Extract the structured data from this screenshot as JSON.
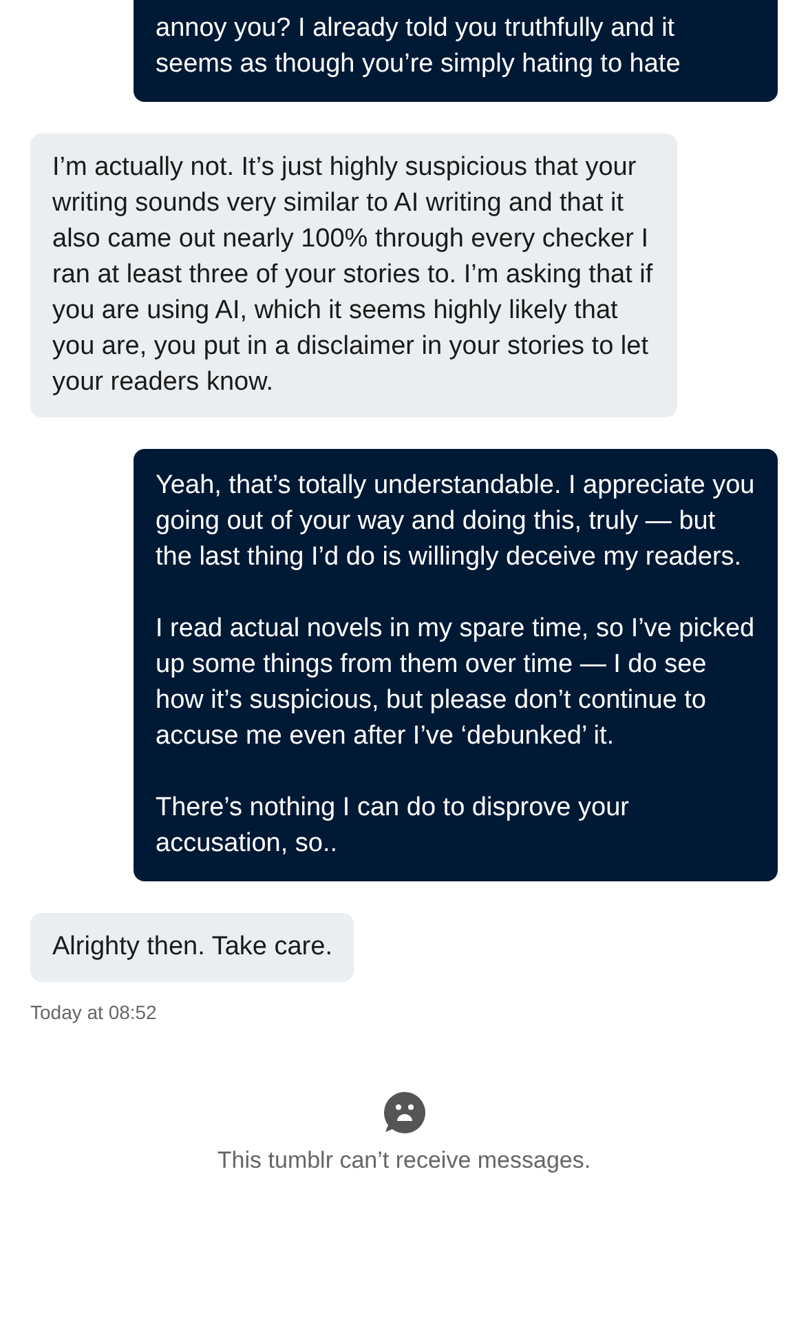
{
  "messages": [
    {
      "kind": "sent",
      "text": "annoy you? I already told you truthfully and it seems as though you’re simply hating to hate"
    },
    {
      "kind": "received",
      "text": "I’m actually not. It’s just highly suspicious that your writing sounds very similar to AI writing and that it also came out nearly 100% through every checker I ran at least three of your stories to. I’m asking that if you are using AI, which it seems highly likely that you are, you put in a disclaimer in your stories to let your readers know."
    },
    {
      "kind": "sent",
      "text": "Yeah, that’s totally understandable. I appreciate you going out of your way and doing this, truly — but the last thing I’d do is willingly deceive my readers.\n\nI read actual novels in my spare time, so I’ve picked up some things from them over time — I do see how it’s suspicious, but please don’t continue to accuse me even after I’ve ‘debunked’ it.\n\nThere’s nothing I can do to disprove your accusation, so.."
    },
    {
      "kind": "received",
      "text": "Alrighty then. Take care."
    }
  ],
  "timestamp": "Today at 08:52",
  "notice": "This tumblr can’t receive messages."
}
